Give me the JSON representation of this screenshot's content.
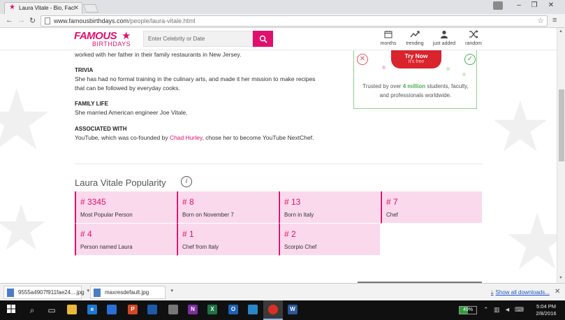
{
  "browser": {
    "tab_title": "Laura Vitale - Bio, Facts, Fa",
    "url_domain": "www.famousbirthdays.com",
    "url_path": "/people/laura-vitale.html"
  },
  "site": {
    "logo_top": "FAMOUS",
    "logo_bottom": "BIRTHDAYS",
    "search_placeholder": "Enter Celebrity or Date",
    "nav": [
      {
        "label": "months",
        "icon": "calendar-icon"
      },
      {
        "label": "trending",
        "icon": "trending-icon"
      },
      {
        "label": "just added",
        "icon": "person-icon"
      },
      {
        "label": "random",
        "icon": "shuffle-icon"
      }
    ]
  },
  "bio": {
    "intro_tail": "worked with her father in their family restaurants in New Jersey.",
    "sections": [
      {
        "heading": "TRIVIA",
        "text": "She has had no formal training in the culinary arts, and made it her mission to make recipes that can be followed by everyday cooks."
      },
      {
        "heading": "FAMILY LIFE",
        "text": "She married American engineer Joe Vitale."
      },
      {
        "heading": "ASSOCIATED WITH",
        "text_before": "YouTube, which was co-founded by ",
        "link": "Chad Hurley",
        "text_after": ", chose her to become YouTube NextChef."
      }
    ]
  },
  "ad": {
    "button_label": "Try Now",
    "button_sub": "It's free",
    "message_before": "Trusted by over ",
    "message_highlight": "4 million",
    "message_after": " students, faculty, and professionals worldwide."
  },
  "popularity": {
    "title": "Laura Vitale Popularity",
    "info_icon": "i",
    "items": [
      {
        "rank": "# 3345",
        "label": "Most Popular Person"
      },
      {
        "rank": "# 8",
        "label": "Born on November 7"
      },
      {
        "rank": "# 13",
        "label": "Born in Italy"
      },
      {
        "rank": "# 7",
        "label": "Chef"
      },
      {
        "rank": "# 4",
        "label": "Person named Laura"
      },
      {
        "rank": "# 1",
        "label": "Chef from Italy"
      },
      {
        "rank": "# 2",
        "label": "Scorpio Chef"
      }
    ]
  },
  "downloads": {
    "files": [
      "9555a4907f911fae24....jpg",
      "maxresdefault.jpg"
    ],
    "show_all": "Show all downloads..."
  },
  "taskbar": {
    "battery": "49%",
    "time": "5:04 PM",
    "date": "2/8/2016"
  },
  "colors": {
    "brand": "#e0106e",
    "popularity_cell": "#fad9ec",
    "ad_border": "#8fd08a",
    "try_button": "#d9232d"
  }
}
